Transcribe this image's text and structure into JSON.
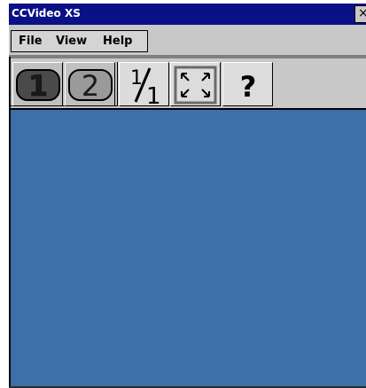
{
  "window": {
    "title": "CCVideo XS",
    "close_glyph": "×",
    "accent": "#0a1086",
    "viewport_color": "#3d6fa8"
  },
  "menu": {
    "items": [
      {
        "label": "File"
      },
      {
        "label": "View"
      },
      {
        "label": "Help"
      }
    ]
  },
  "toolbar": {
    "buttons": [
      {
        "icon": "camera-1-icon",
        "label": "1"
      },
      {
        "icon": "camera-2-icon",
        "label": "2"
      },
      {
        "icon": "actual-size-icon",
        "label": "1/1"
      },
      {
        "icon": "fullscreen-icon"
      },
      {
        "icon": "help-icon",
        "label": "?"
      }
    ]
  }
}
